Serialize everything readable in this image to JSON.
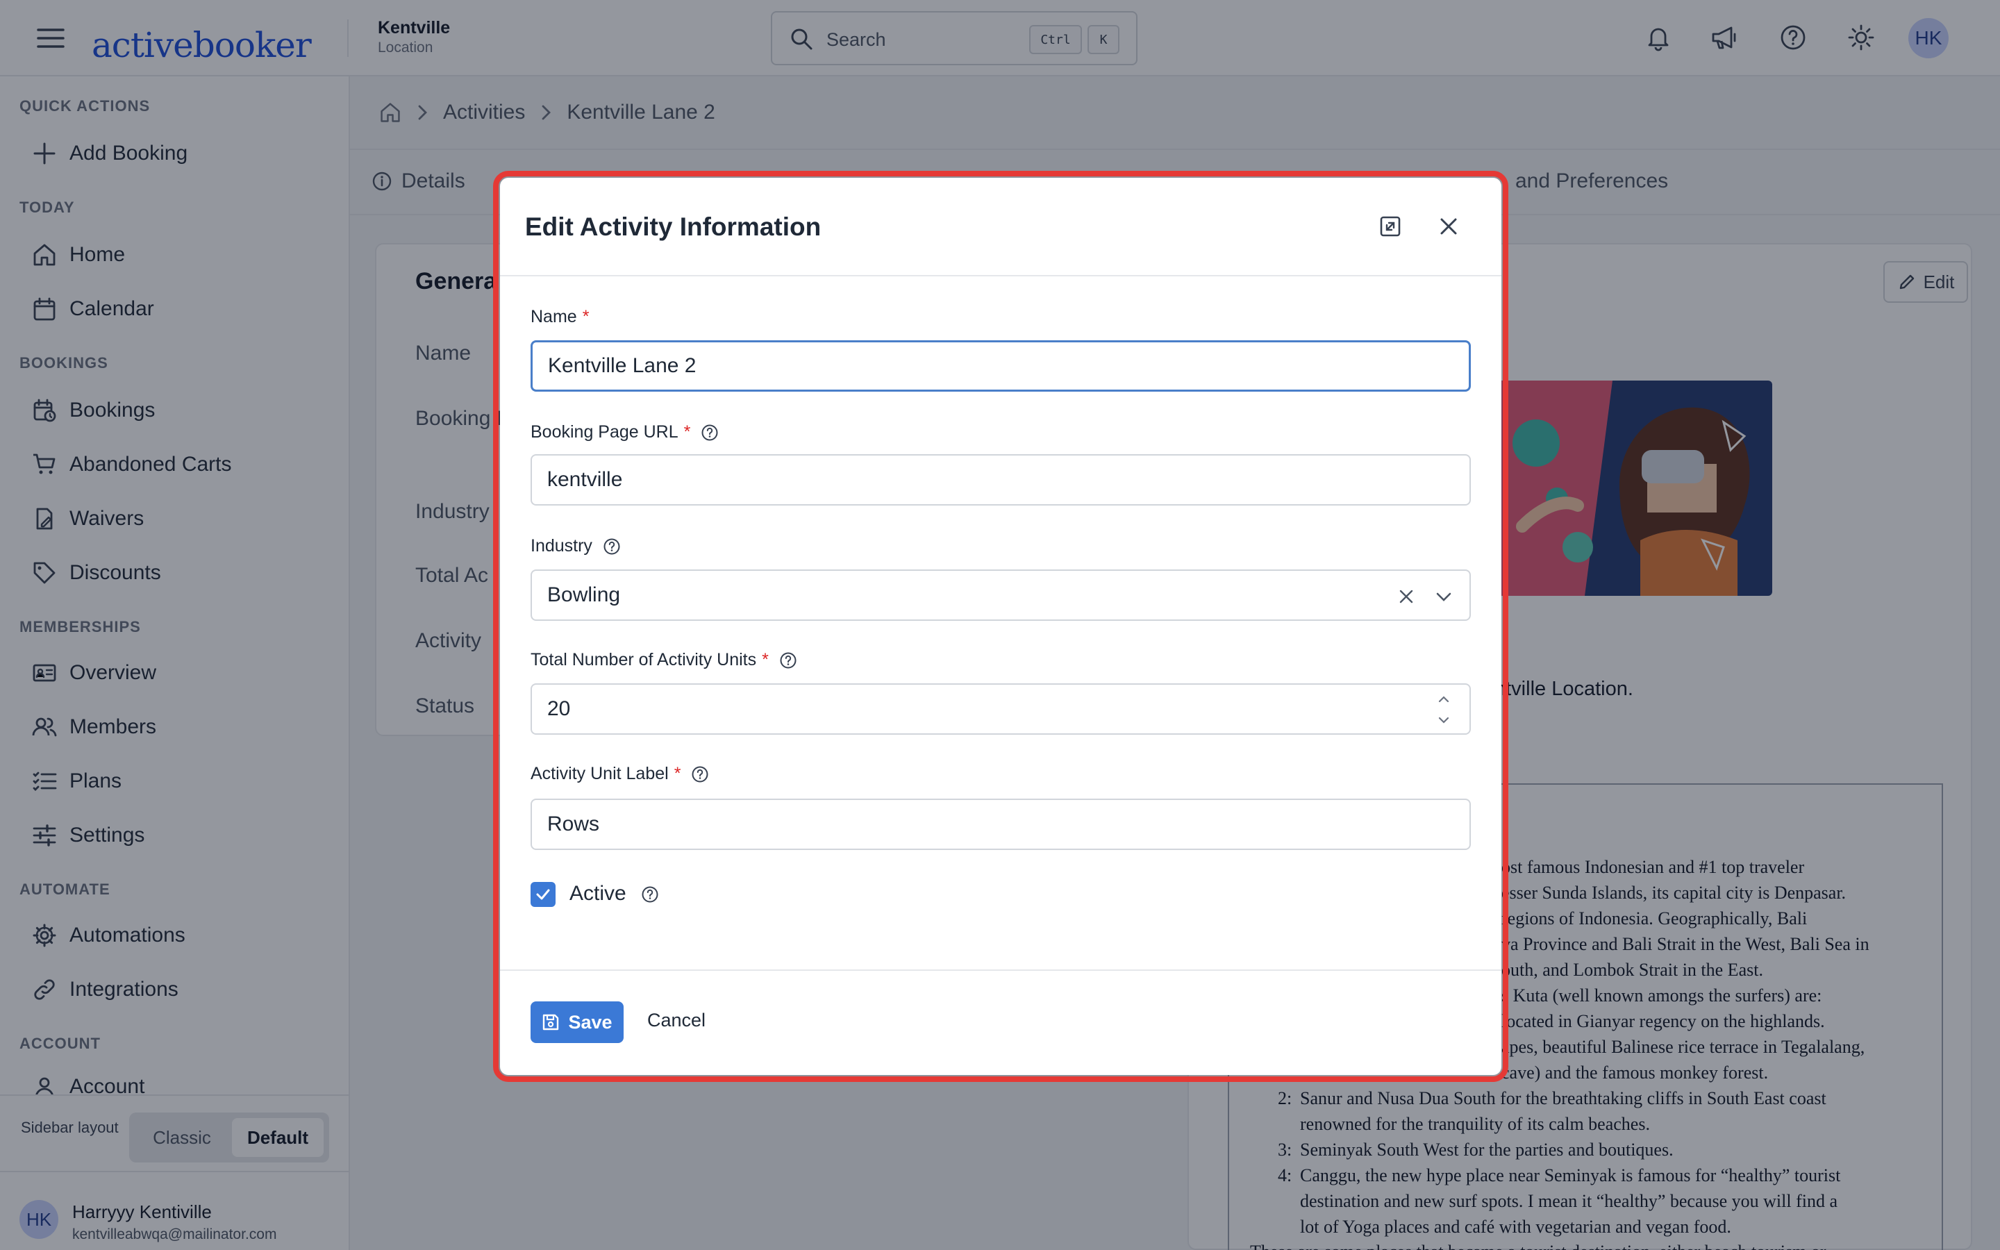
{
  "topbar": {
    "brand": "activebooker",
    "location_name": "Kentville",
    "location_type": "Location",
    "search_placeholder": "Search",
    "shortcut_ctrl": "Ctrl",
    "shortcut_key": "K",
    "avatar_initials": "HK"
  },
  "sidebar": {
    "sections": {
      "quick_actions": "QUICK ACTIONS",
      "today": "TODAY",
      "bookings": "BOOKINGS",
      "memberships": "MEMBERSHIPS",
      "automate": "AUTOMATE",
      "account": "ACCOUNT"
    },
    "items": {
      "add_booking": "Add Booking",
      "home": "Home",
      "calendar": "Calendar",
      "bookings": "Bookings",
      "abandoned_carts": "Abandoned Carts",
      "waivers": "Waivers",
      "discounts": "Discounts",
      "overview": "Overview",
      "members": "Members",
      "plans": "Plans",
      "settings": "Settings",
      "automations": "Automations",
      "integrations": "Integrations",
      "account": "Account"
    },
    "layout_label": "Sidebar layout",
    "layout_classic": "Classic",
    "layout_default": "Default",
    "user_initials": "HK",
    "user_name": "Harryyy Kentiville",
    "user_email": "kentvilleabwqa@mailinator.com"
  },
  "breadcrumb": {
    "activities": "Activities",
    "current": "Kentville Lane 2"
  },
  "tabs": {
    "details": "Details",
    "settings_prefs": "and Preferences"
  },
  "background_card": {
    "title": "Genera",
    "labels": [
      "Name",
      "Booking I",
      "Industry",
      "Total Ac",
      "Activity",
      "Status"
    ],
    "edit_label": "Edit",
    "description_line": "ntville Location.",
    "description_text": [
      "ost famous Indonesian and #1 top traveler",
      "esser Sunda Islands, its capital city is Denpasar.",
      "regions of Indonesia. Geographically, Bali",
      "va Province and Bali Strait in the West, Bali Sea in",
      "outh, and Lombok Strait in the East.",
      "s Kuta (well known amongs the surfers) are:",
      "located in Gianyar regency on the highlands.",
      "apes, beautiful Balinese rice terrace in Tegalalang,",
      "cave) and the famous monkey forest."
    ],
    "list_items": [
      {
        "num": "2:",
        "lines": [
          "Sanur and Nusa Dua South for the breathtaking cliffs in South East coast",
          "renowned for the tranquility of its calm beaches."
        ]
      },
      {
        "num": "3:",
        "lines": [
          "Seminyak South West for the parties and boutiques."
        ]
      },
      {
        "num": "4:",
        "lines": [
          "Canggu, the new hype place near Seminyak is famous for “healthy” tourist",
          "destination and new surf spots. I mean it “healthy” because you will find a",
          "lot of Yoga places and café with vegetarian and vegan food."
        ]
      }
    ],
    "trailing_text": "These are some places that became a tourist destination, either beach tourism or"
  },
  "modal": {
    "title": "Edit Activity Information",
    "name_label": "Name",
    "name_value": "Kentville Lane 2",
    "url_label": "Booking Page URL",
    "url_value": "kentville",
    "industry_label": "Industry",
    "industry_value": "Bowling",
    "units_label": "Total Number of Activity Units",
    "units_value": "20",
    "unit_label_label": "Activity Unit Label",
    "unit_label_value": "Rows",
    "active_label": "Active",
    "active_checked": true,
    "required_mark": "*",
    "save_label": "Save",
    "cancel_label": "Cancel"
  },
  "colors": {
    "brand": "#1d4ed8",
    "primary_button": "#3b79d6",
    "highlight": "#e53935",
    "required": "#dc2626"
  }
}
